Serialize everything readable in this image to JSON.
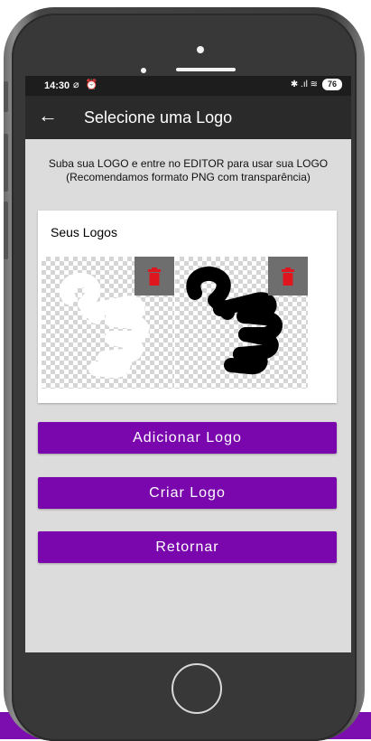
{
  "status_bar": {
    "time": "14:30",
    "left_icons": "⌀ ⏰",
    "right_icons": "✱ .ıl ≋",
    "battery": "76"
  },
  "app_bar": {
    "back_label": "←",
    "title": "Selecione uma Logo"
  },
  "info": {
    "line1": "Suba sua LOGO e entre no EDITOR para usar sua LOGO",
    "line2": "(Recomendamos formato PNG com transparência)"
  },
  "logos_card": {
    "title": "Seus Logos",
    "logos": [
      {
        "color": "#ffffff",
        "icon": "hand-pointing-logo"
      },
      {
        "color": "#000000",
        "icon": "hand-pointing-logo"
      }
    ]
  },
  "buttons": {
    "add": "Adicionar Logo",
    "create": "Criar Logo",
    "back": "Retornar"
  },
  "colors": {
    "accent": "#7a06ad",
    "app_bar": "#2a2a2a",
    "trash": "#e0161e"
  }
}
